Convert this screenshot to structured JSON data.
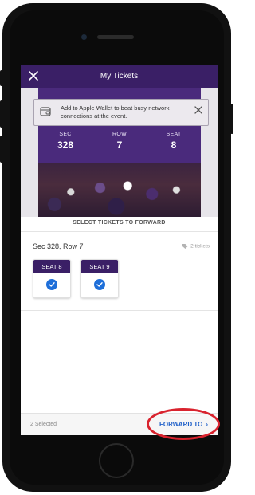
{
  "header": {
    "title": "My Tickets"
  },
  "banner": {
    "text": "Add to Apple Wallet to beat busy network connections at the event."
  },
  "seat_info": [
    {
      "label": "SEC",
      "value": "328"
    },
    {
      "label": "ROW",
      "value": "7"
    },
    {
      "label": "SEAT",
      "value": "8"
    }
  ],
  "select": {
    "title": "SELECT TICKETS TO FORWARD"
  },
  "group": {
    "label": "Sec 328, Row 7",
    "count": "2 tickets"
  },
  "seats": [
    {
      "label": "SEAT 8",
      "selected": true
    },
    {
      "label": "SEAT 9",
      "selected": true
    }
  ],
  "footer": {
    "selected": "2 Selected",
    "forward_label": "FORWARD TO",
    "chevron": "›"
  },
  "colors": {
    "brand": "#3a1f66",
    "accent": "#1e6fd9",
    "highlight": "#d9232e"
  },
  "icons": {
    "close": "close-icon",
    "wallet": "wallet-icon",
    "tag": "tag-icon",
    "check": "check-icon"
  }
}
